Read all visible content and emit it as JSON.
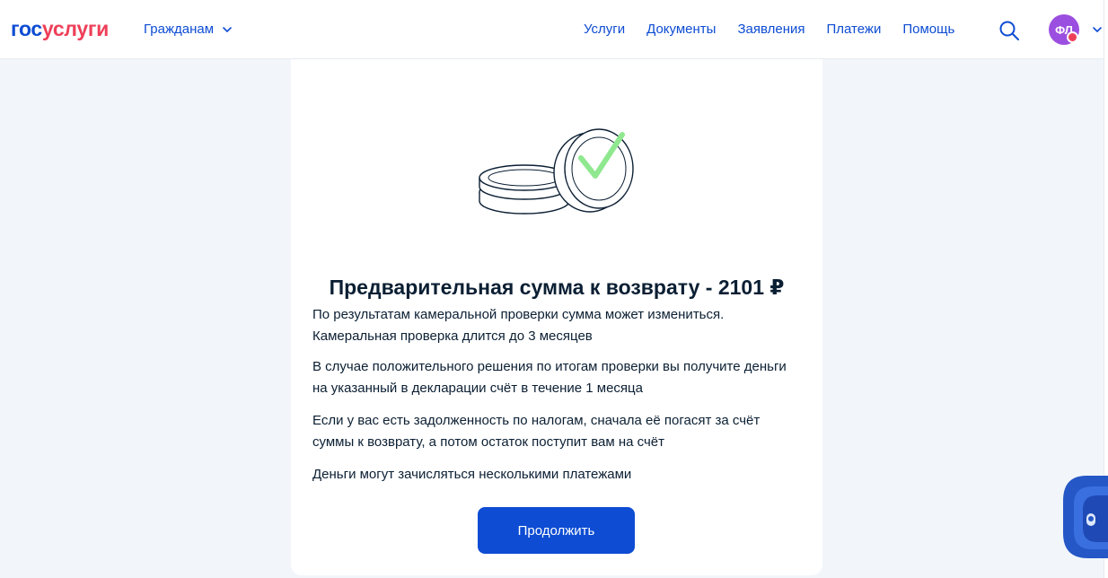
{
  "header": {
    "logo": {
      "part1": "гос",
      "part2": "услуги"
    },
    "audience_label": "Гражданам",
    "nav": [
      {
        "label": "Услуги"
      },
      {
        "label": "Документы"
      },
      {
        "label": "Заявления"
      },
      {
        "label": "Платежи"
      },
      {
        "label": "Помощь"
      }
    ],
    "search_icon": "search-icon",
    "avatar_initials": "ФЛ"
  },
  "card": {
    "illustration": "coins-checkmark-illustration",
    "title": "Предварительная сумма к возврату - 2101 ₽",
    "paragraphs": [
      "По результатам камеральной проверки сумма может измениться. Камеральная проверка длится до 3 месяцев",
      "В случае положительного решения по итогам проверки вы получите деньги на указанный в декларации счёт в течение 1 месяца",
      "Если у вас есть задолженность по налогам, сначала её погасят за счёт суммы к возврату, а потом остаток поступит вам на счёт",
      "Деньги могут зачисляться несколькими платежами"
    ],
    "continue_label": "Продолжить"
  },
  "colors": {
    "brand_blue": "#0d4cd3",
    "brand_red": "#ee3f58",
    "check_green": "#8fe88f",
    "avatar_purple": "#9b4fe0",
    "page_bg": "#f2f6fa"
  }
}
